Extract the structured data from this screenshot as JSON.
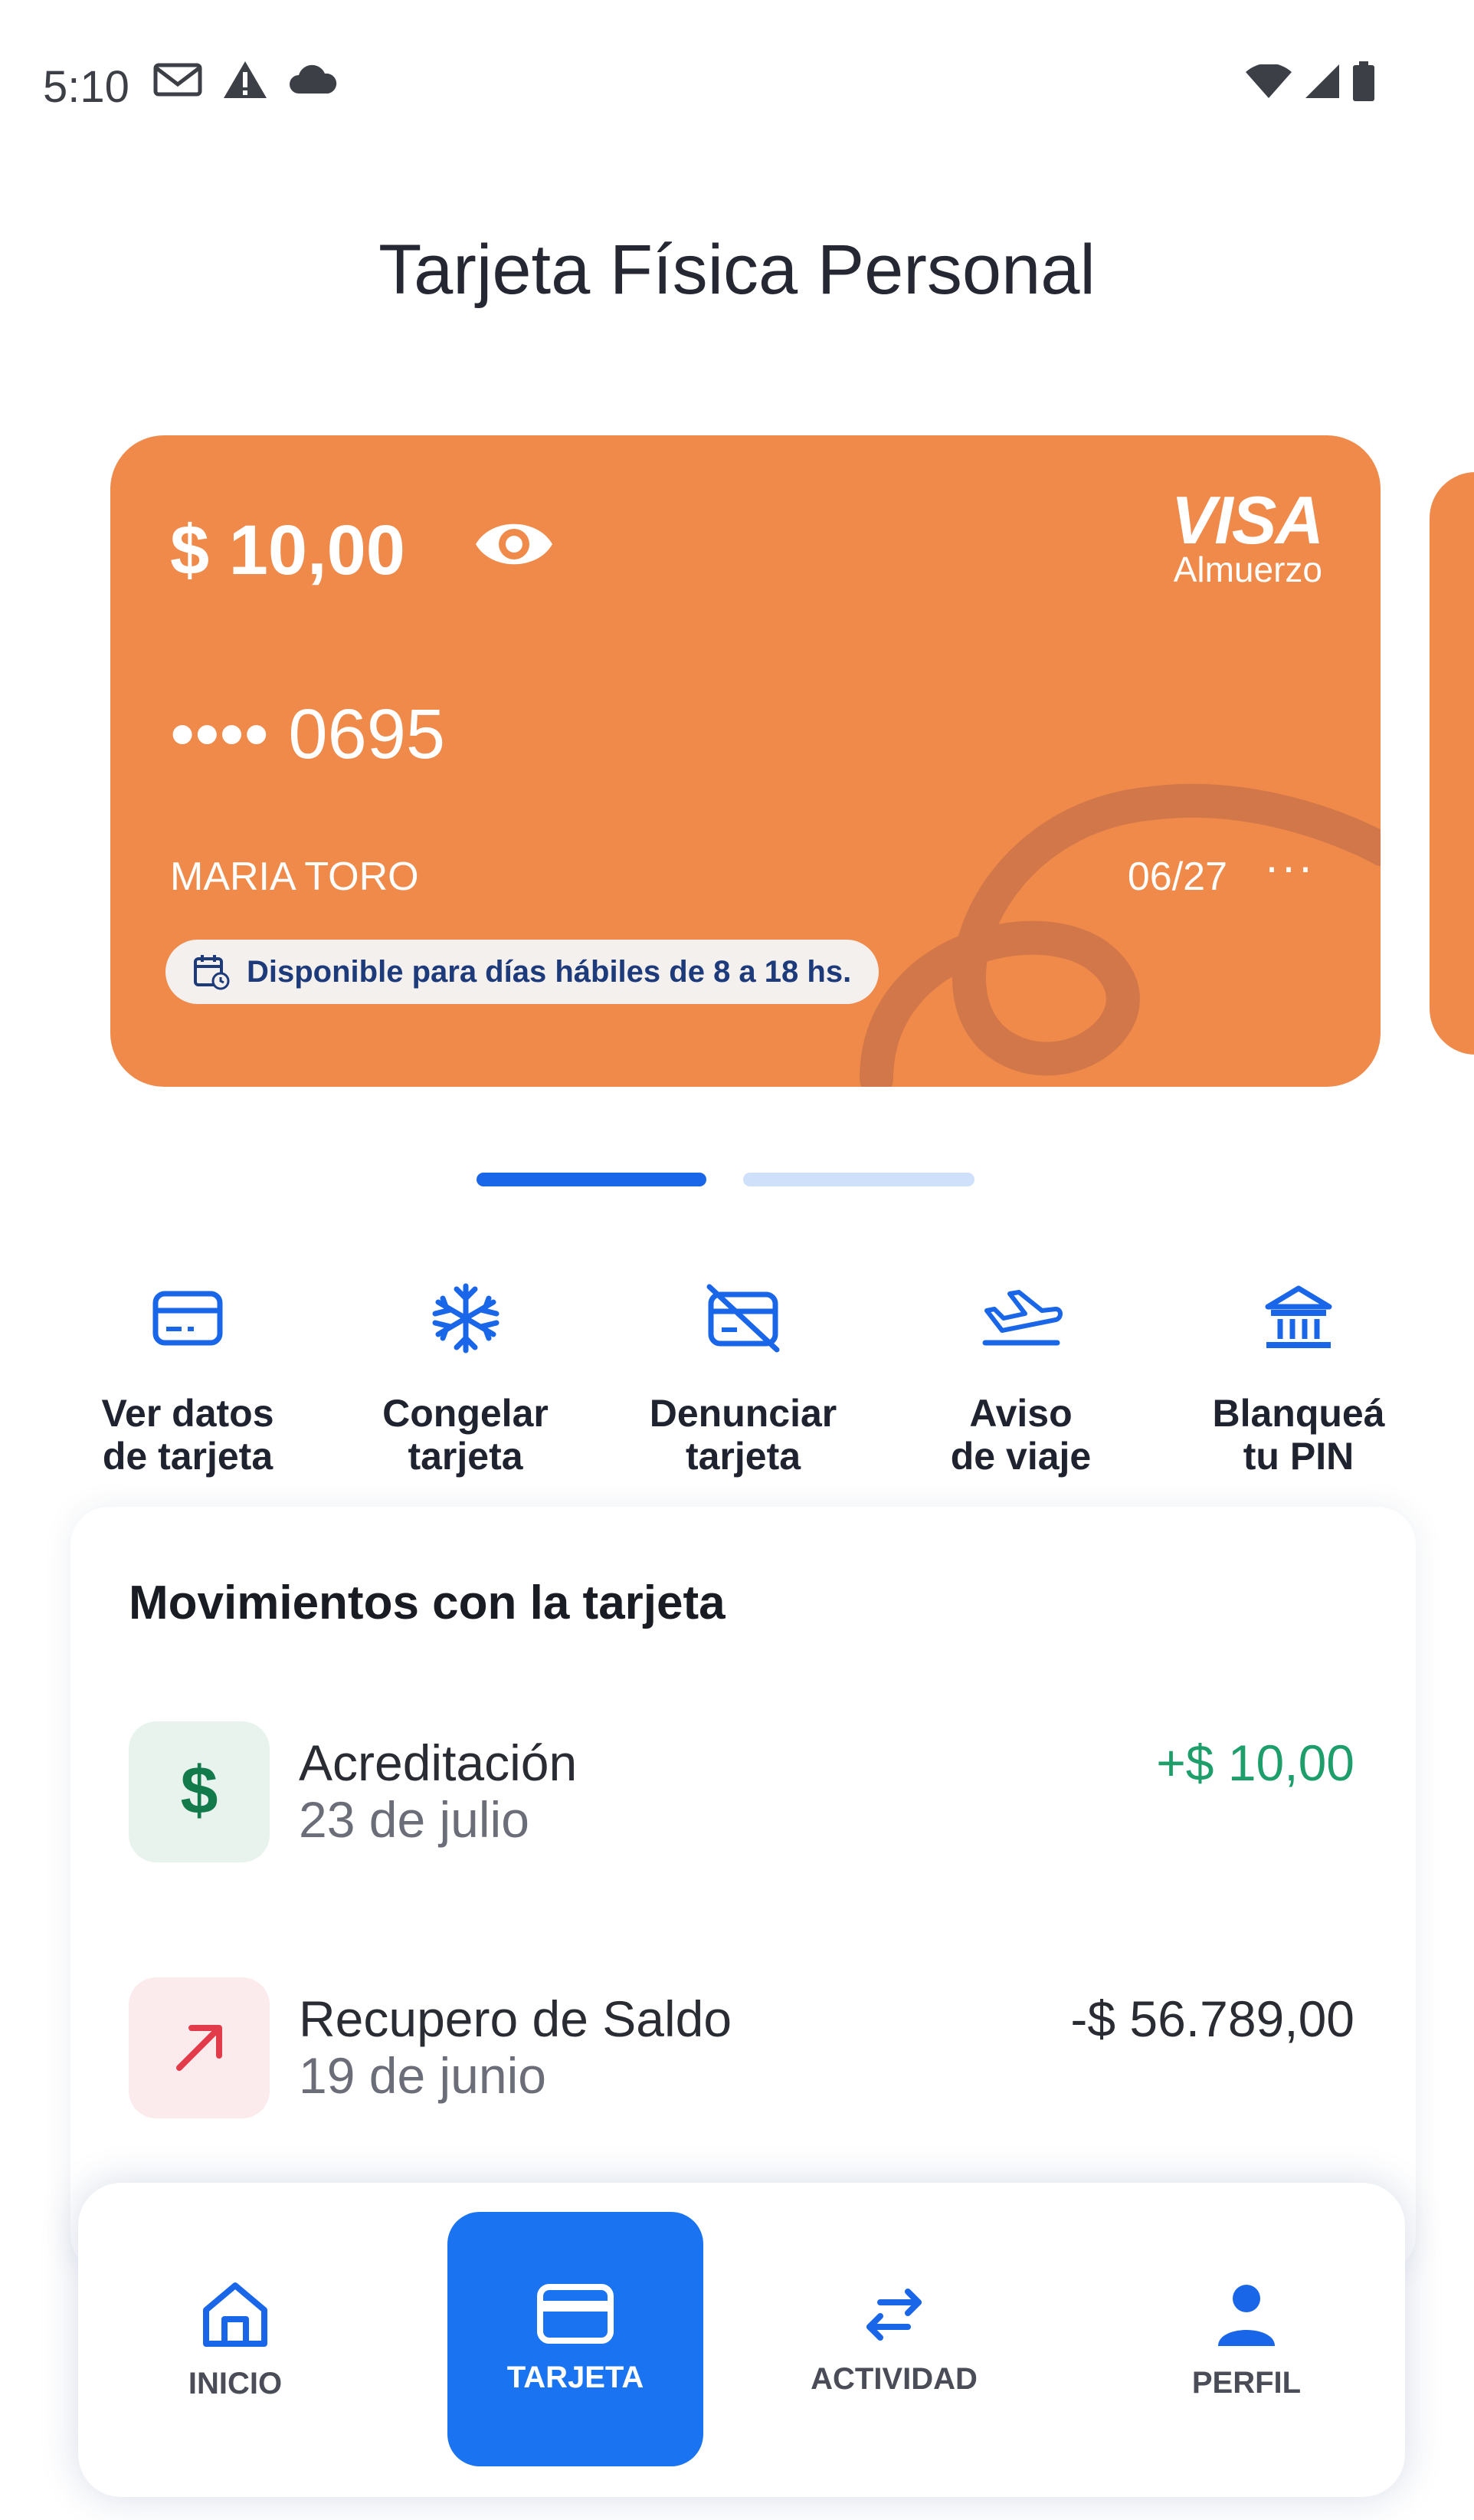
{
  "status_bar": {
    "time": "5:10"
  },
  "title": "Tarjeta Física Personal",
  "card": {
    "balance": "$ 10,00",
    "brand": "VISA",
    "brand_sub": "Almuerzo",
    "number": "•••• 0695",
    "holder": "MARIA TORO",
    "expiry": "06/27",
    "more": "···",
    "availability": "Disponible para días hábiles de 8 a 18 hs.",
    "color": "#ef8a4a"
  },
  "pager": {
    "count": 2,
    "active": 0
  },
  "actions": [
    {
      "line1": "Ver datos",
      "line2": "de tarjeta",
      "icon": "card-icon"
    },
    {
      "line1": "Congelar",
      "line2": "tarjeta",
      "icon": "snowflake-icon"
    },
    {
      "line1": "Denunciar",
      "line2": "tarjeta",
      "icon": "card-off-icon"
    },
    {
      "line1": "Aviso",
      "line2": "de viaje",
      "icon": "plane-icon"
    },
    {
      "line1": "Blanqueá",
      "line2": "tu PIN",
      "icon": "bank-icon"
    }
  ],
  "movements": {
    "title": "Movimientos con la tarjeta",
    "items": [
      {
        "name": "Acreditación",
        "date": "23 de julio",
        "amount": "+$ 10,00",
        "icon": "dollar-icon",
        "amount_color": "#1e9e6a"
      },
      {
        "name": "Recupero de Saldo",
        "date": "19 de junio",
        "amount": "-$ 56.789,00",
        "icon": "arrow-up-right-icon",
        "amount_color": "#2a2c34"
      }
    ]
  },
  "nav": {
    "items": [
      {
        "label": "INICIO",
        "icon": "home-icon"
      },
      {
        "label": "TARJETA",
        "icon": "card-icon",
        "active": true
      },
      {
        "label": "ACTIVIDAD",
        "icon": "swap-icon"
      },
      {
        "label": "PERFIL",
        "icon": "person-icon"
      }
    ]
  },
  "colors": {
    "accent": "#1a73f0",
    "card": "#ef8a4a",
    "positive": "#1e9e6a",
    "negative_icon": "#e23b4a"
  }
}
